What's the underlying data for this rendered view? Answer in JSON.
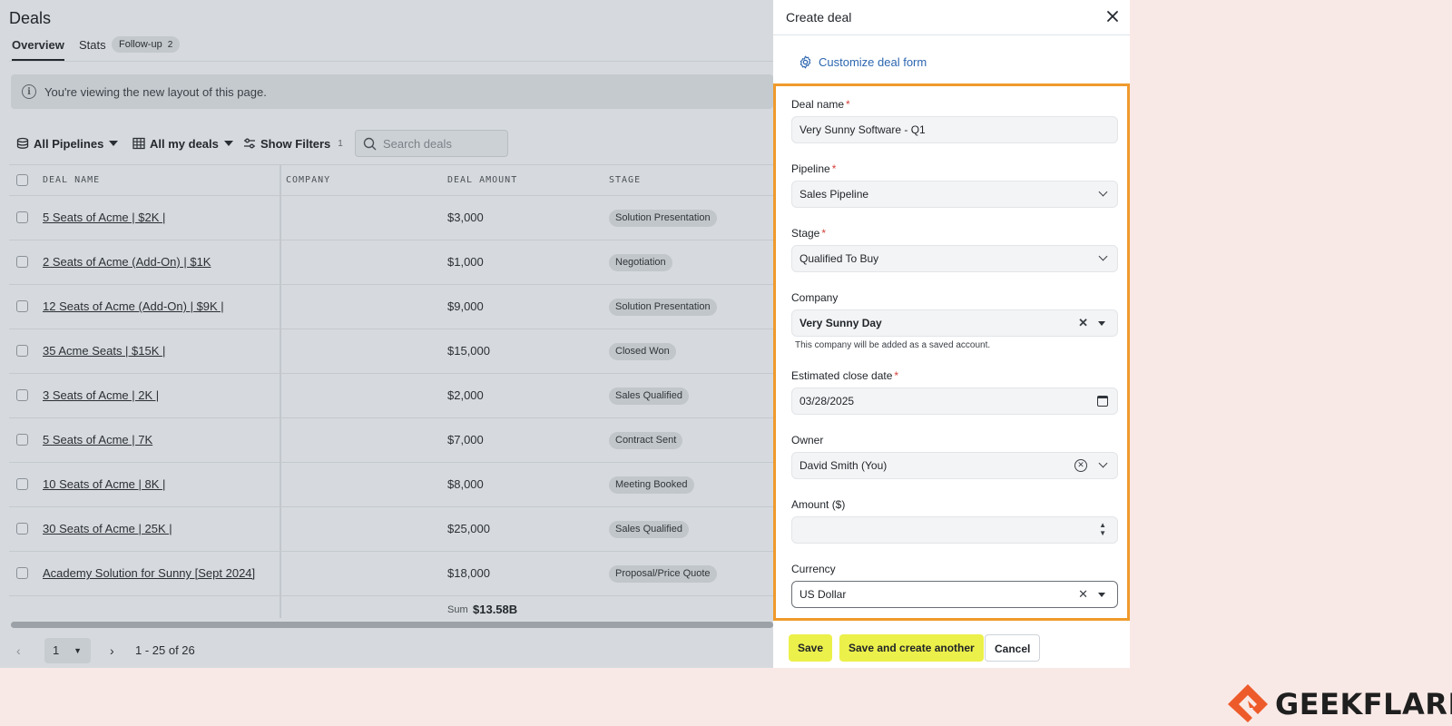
{
  "app": {
    "page_title": "Deals",
    "tabs": [
      {
        "label": "Overview"
      },
      {
        "label": "Stats"
      },
      {
        "label": "Follow-up",
        "count": "2"
      }
    ],
    "banner_text": "You're viewing the new layout of this page.",
    "toolbar": {
      "pipelines_label": "All Pipelines",
      "view_label": "All my deals",
      "filters_label": "Show Filters",
      "filters_count": "1",
      "search_placeholder": "Search deals"
    },
    "table": {
      "headers": [
        "DEAL NAME",
        "COMPANY",
        "DEAL AMOUNT",
        "STAGE"
      ],
      "rows": [
        {
          "name": "5 Seats of Acme | $2K |",
          "amount": "$3,000",
          "stage": "Solution Presentation"
        },
        {
          "name": "2 Seats of Acme (Add-On) | $1K",
          "amount": "$1,000",
          "stage": "Negotiation"
        },
        {
          "name": "12 Seats of Acme (Add-On) | $9K |",
          "amount": "$9,000",
          "stage": "Solution Presentation"
        },
        {
          "name": "35 Acme Seats | $15K |",
          "amount": "$15,000",
          "stage": "Closed Won"
        },
        {
          "name": "3 Seats of Acme | 2K |",
          "amount": "$2,000",
          "stage": "Sales Qualified"
        },
        {
          "name": "5 Seats of Acme | 7K",
          "amount": "$7,000",
          "stage": "Contract Sent"
        },
        {
          "name": "10 Seats of Acme | 8K |",
          "amount": "$8,000",
          "stage": "Meeting Booked"
        },
        {
          "name": "30 Seats of Acme | 25K |",
          "amount": "$25,000",
          "stage": "Sales Qualified"
        },
        {
          "name": "Academy Solution for Sunny [Sept 2024]",
          "amount": "$18,000",
          "stage": "Proposal/Price Quote"
        }
      ],
      "sum_label": "Sum",
      "sum_value": "$13.58B"
    },
    "pager": {
      "page": "1",
      "range": "1 - 25 of 26"
    }
  },
  "panel": {
    "title": "Create deal",
    "customize_label": "Customize deal form",
    "fields": {
      "deal_name": {
        "label": "Deal name",
        "value": "Very Sunny Software - Q1"
      },
      "pipeline": {
        "label": "Pipeline",
        "value": "Sales Pipeline"
      },
      "stage": {
        "label": "Stage",
        "value": "Qualified To Buy"
      },
      "company": {
        "label": "Company",
        "value": "Very Sunny Day",
        "helper": "This company will be added as a saved account."
      },
      "close_date": {
        "label": "Estimated close date",
        "value": "03/28/2025"
      },
      "owner": {
        "label": "Owner",
        "value": "David Smith (You)"
      },
      "amount": {
        "label": "Amount ($)",
        "value": ""
      },
      "currency": {
        "label": "Currency",
        "value": "US Dollar"
      }
    },
    "required_mark": "*",
    "buttons": {
      "save": "Save",
      "save_another": "Save and create another",
      "cancel": "Cancel"
    }
  },
  "brand": {
    "name": "GEEKFLARE"
  },
  "colors": {
    "highlight_border": "#ef9a2c",
    "primary_button": "#ecf04a",
    "link": "#2c66b0",
    "required": "#d6403a",
    "brand_accent": "#ee5b2b"
  }
}
